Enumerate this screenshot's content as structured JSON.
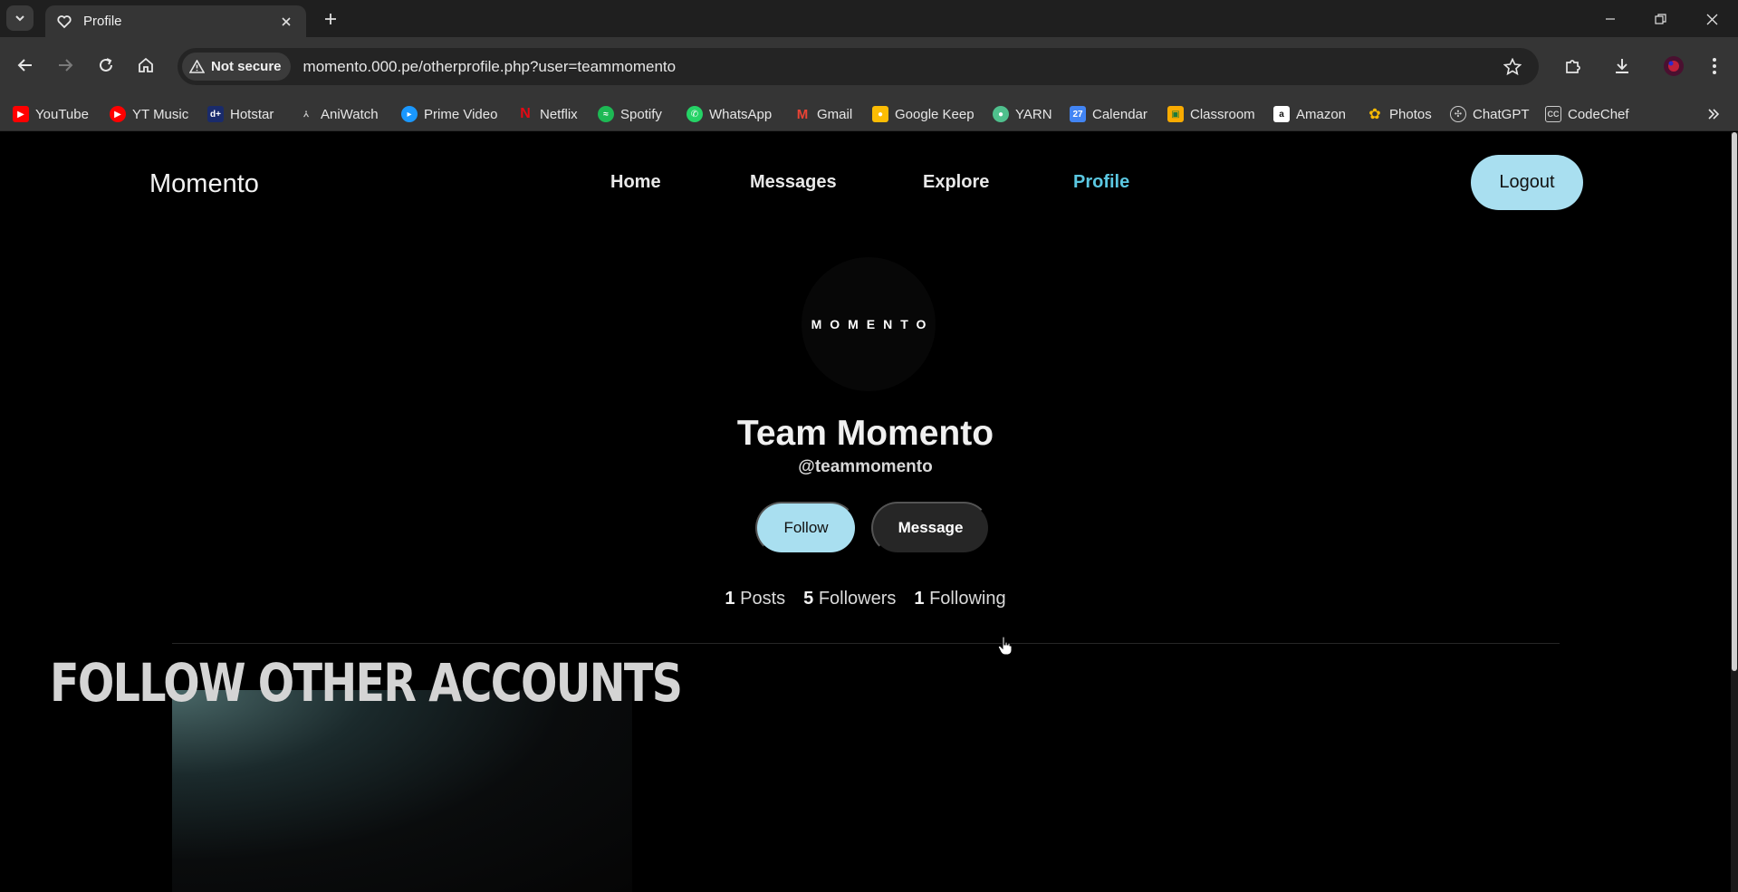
{
  "browser": {
    "tab": {
      "title": "Profile"
    },
    "security_label": "Not secure",
    "url": "momento.000.pe/otherprofile.php?user=teammomento",
    "bookmarks": [
      {
        "label": "YouTube",
        "icon": "youtube-icon",
        "color": "#ff0000"
      },
      {
        "label": "YT Music",
        "icon": "yt-music-icon",
        "color": "#ff0000"
      },
      {
        "label": "Hotstar",
        "icon": "hotstar-icon",
        "color": "#1a2b6b"
      },
      {
        "label": "AniWatch",
        "icon": "aniwatch-icon",
        "color": "#cccccc"
      },
      {
        "label": "Prime Video",
        "icon": "prime-video-icon",
        "color": "#1a98ff"
      },
      {
        "label": "Netflix",
        "icon": "netflix-icon",
        "color": "#e50914"
      },
      {
        "label": "Spotify",
        "icon": "spotify-icon",
        "color": "#1db954"
      },
      {
        "label": "WhatsApp",
        "icon": "whatsapp-icon",
        "color": "#25d366"
      },
      {
        "label": "Gmail",
        "icon": "gmail-icon",
        "color": "#ea4335"
      },
      {
        "label": "Google Keep",
        "icon": "google-keep-icon",
        "color": "#fbbc04"
      },
      {
        "label": "YARN",
        "icon": "yarn-icon",
        "color": "#4fc08d"
      },
      {
        "label": "Calendar",
        "icon": "calendar-icon",
        "color": "#4285f4"
      },
      {
        "label": "Classroom",
        "icon": "classroom-icon",
        "color": "#f9ab00"
      },
      {
        "label": "Amazon",
        "icon": "amazon-icon",
        "color": "#ffffff"
      },
      {
        "label": "Photos",
        "icon": "photos-icon",
        "color": "#ea4335"
      },
      {
        "label": "ChatGPT",
        "icon": "chatgpt-icon",
        "color": "#cccccc"
      },
      {
        "label": "CodeChef",
        "icon": "codechef-icon",
        "color": "#cccccc"
      }
    ]
  },
  "site": {
    "brand": "Momento",
    "nav": {
      "home": "Home",
      "messages": "Messages",
      "explore": "Explore",
      "profile": "Profile"
    },
    "logout_label": "Logout",
    "accent_color": "#5bc8e2",
    "button_color": "#a9dff0"
  },
  "profile": {
    "avatar_text": "MOMENTO",
    "display_name": "Team Momento",
    "handle": "@teammomento",
    "follow_label": "Follow",
    "message_label": "Message",
    "stats": {
      "posts_count": "1",
      "posts_label": "Posts",
      "followers_count": "5",
      "followers_label": "Followers",
      "following_count": "1",
      "following_label": "Following"
    }
  },
  "overlay": {
    "caption": "FOLLOW OTHER ACCOUNTS"
  }
}
